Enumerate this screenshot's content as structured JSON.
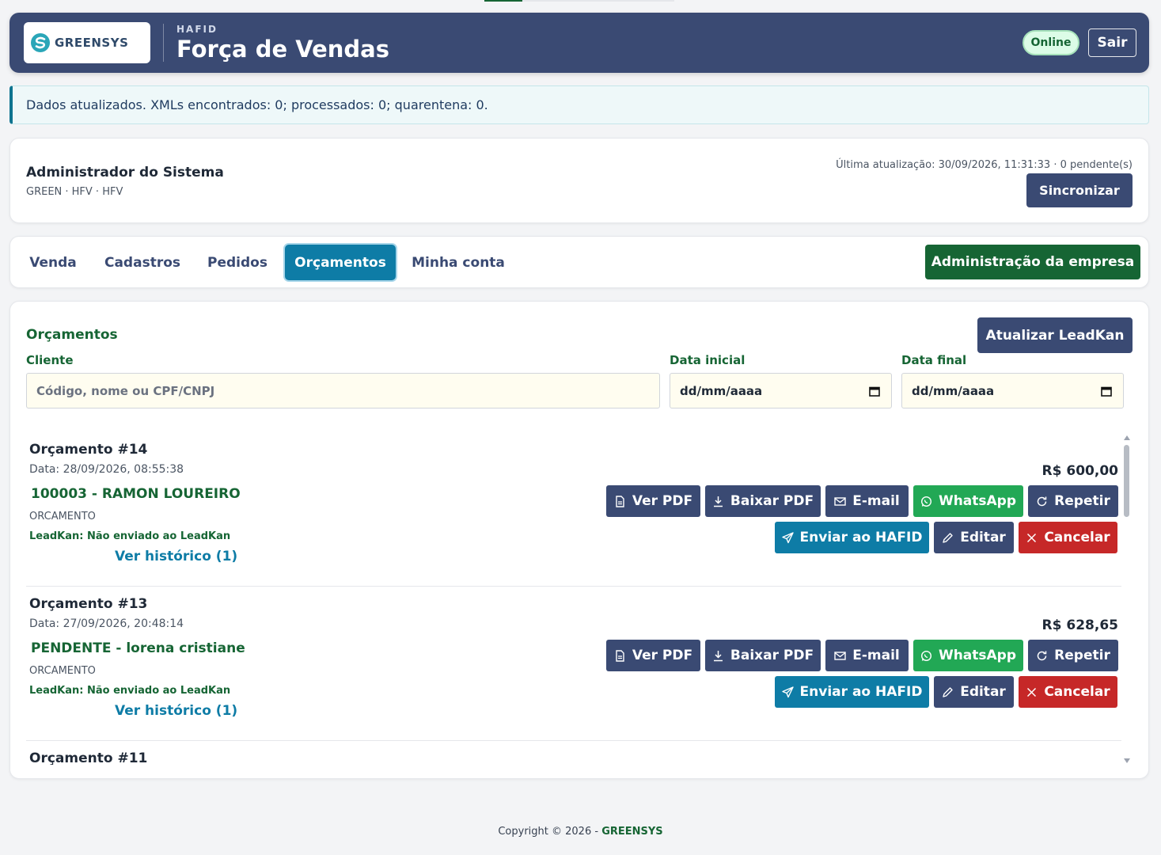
{
  "header": {
    "logo_text": "GREENSYS",
    "subtitle": "HAFID",
    "title": "Força de Vendas",
    "status": "Online",
    "logout": "Sair"
  },
  "alert": {
    "message": "Dados atualizados. XMLs encontrados: 0; processados: 0; quarentena: 0."
  },
  "user": {
    "name": "Administrador do Sistema",
    "meta": "GREEN · HFV · HFV",
    "last_update": "Última atualização: 30/09/2026, 11:31:33 · 0 pendente(s)",
    "sync": "Sincronizar"
  },
  "nav": {
    "tabs": [
      {
        "label": "Venda"
      },
      {
        "label": "Cadastros"
      },
      {
        "label": "Pedidos"
      },
      {
        "label": "Orçamentos"
      },
      {
        "label": "Minha conta"
      }
    ],
    "active_tab": "Orçamentos",
    "admin": "Administração da empresa"
  },
  "quotes_section": {
    "title": "Orçamentos",
    "refresh": "Atualizar LeadKan",
    "client_label": "Cliente",
    "client_placeholder": "Código, nome ou CPF/CNPJ",
    "start_label": "Data inicial",
    "start_value": "dd/mm/aaaa",
    "end_label": "Data final",
    "end_value": "dd/mm/aaaa"
  },
  "buttons": {
    "view_pdf": "Ver PDF",
    "download_pdf": "Baixar PDF",
    "email": "E-mail",
    "whatsapp": "WhatsApp",
    "repeat": "Repetir",
    "send": "Enviar ao HAFID",
    "edit": "Editar",
    "cancel": "Cancelar"
  },
  "quotes": [
    {
      "title": "Orçamento #14",
      "date": "Data: 28/09/2026, 08:55:38",
      "client": "100003 - RAMON LOUREIRO",
      "type": "ORCAMENTO",
      "leadkan": "LeadKan: Não enviado ao LeadKan",
      "history": "Ver histórico (1)",
      "total": "R$ 600,00"
    },
    {
      "title": "Orçamento #13",
      "date": "Data: 27/09/2026, 20:48:14",
      "client": "PENDENTE - lorena cristiane",
      "type": "ORCAMENTO",
      "leadkan": "LeadKan: Não enviado ao LeadKan",
      "history": "Ver histórico (1)",
      "total": "R$ 628,65"
    },
    {
      "title": "Orçamento #11"
    }
  ],
  "footer": {
    "copyright": "Copyright © 2026 -",
    "brand": "GREENSYS"
  },
  "colors": {
    "header_bg": "#3a4a73",
    "primary_green": "#166534",
    "accent_blue": "#0e7ca6",
    "whatsapp_green": "#22a855",
    "danger_red": "#c62828"
  }
}
